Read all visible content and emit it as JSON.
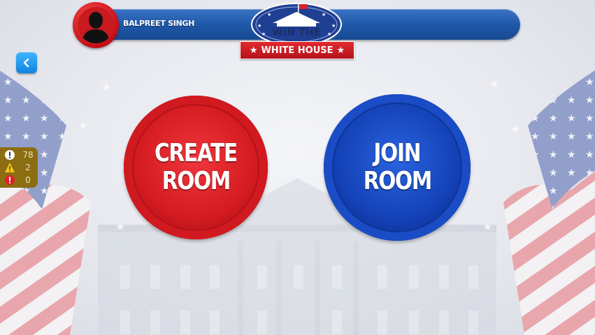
{
  "player": {
    "name": "BALPREET SINGH"
  },
  "logo": {
    "line1": "WIN THE",
    "line2": "WHITE HOUSE",
    "star": "★"
  },
  "stats": [
    {
      "icon": "info-icon",
      "value": "78",
      "color": "#ffffff"
    },
    {
      "icon": "warning-icon",
      "value": "2",
      "color": "#f3c61a"
    },
    {
      "icon": "error-icon",
      "value": "0",
      "color": "#e0202a"
    }
  ],
  "buttons": {
    "create": {
      "line1": "CREATE",
      "line2": "ROOM",
      "color": "#d31b21"
    },
    "join": {
      "line1": "JOIN",
      "line2": "ROOM",
      "color": "#1441b6"
    }
  },
  "colors": {
    "header": "#1e56a6",
    "back": "#1e90ff"
  }
}
